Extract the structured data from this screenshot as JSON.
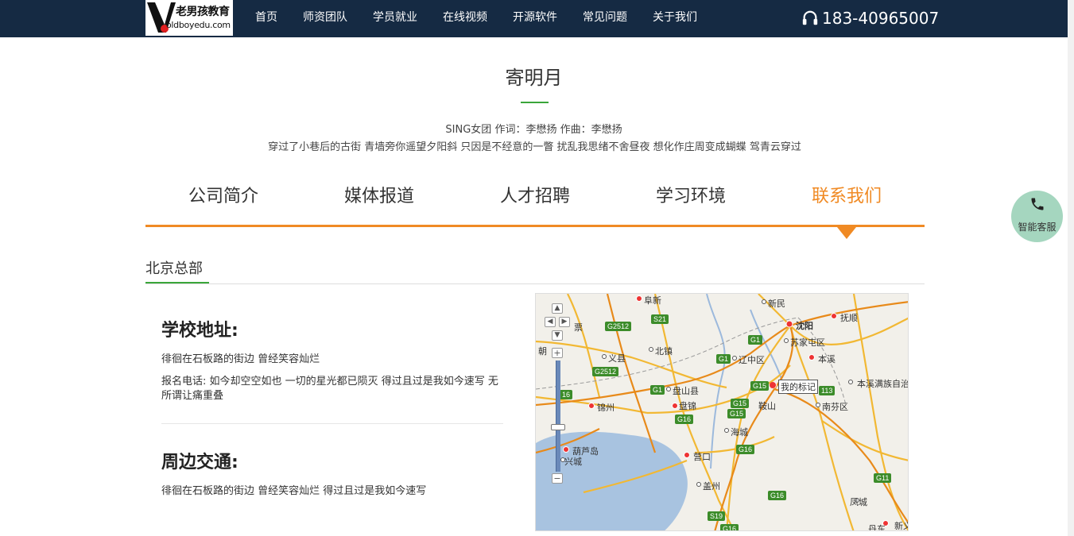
{
  "header": {
    "logo_cn": "老男孩教育",
    "logo_url": "oldboyedu.com",
    "nav": [
      "首页",
      "师资团队",
      "学员就业",
      "在线视频",
      "开源软件",
      "常见问题",
      "关于我们"
    ],
    "phone": "183-40965007",
    "phone_icon": "headphones-icon"
  },
  "title": {
    "main": "寄明月",
    "subtitle": "SING女团 作词：李懋扬 作曲：李懋扬",
    "lyric": "穿过了小巷后的古街 青墙旁你遥望夕阳斜 只因是不经意的一瞥 扰乱我思绪不舍昼夜 想化作庄周变成蝴蝶 驾青云穿过"
  },
  "tabs": {
    "items": [
      "公司简介",
      "媒体报道",
      "人才招聘",
      "学习环境",
      "联系我们"
    ],
    "active": 4
  },
  "section": {
    "title": "北京总部"
  },
  "address": {
    "heading": "学校地址:",
    "line1": "徘徊在石板路的街边 曾经笑容灿烂",
    "line2": "报名电话: 如今却空空如也 一切的星光都已陨灭 得过且过是我如今速写 无所谓让痛重叠"
  },
  "traffic": {
    "heading": "周边交通:",
    "line1": "徘徊在石板路的街边 曾经笑容灿烂 得过且过是我如今速写"
  },
  "map": {
    "marker_label": "我的标记",
    "places": [
      "阜新",
      "新民",
      "沈阳",
      "抚顺",
      "苏家屯区",
      "本溪",
      "辽中区",
      "义县",
      "北镇",
      "盘山县",
      "盘锦",
      "鞍山",
      "锦州",
      "海城",
      "南芬区",
      "本溪满族自治",
      "葫芦岛",
      "兴城",
      "营口",
      "盖州",
      "凤城",
      "丹东",
      "新义",
      "朝",
      "票"
    ],
    "roads": [
      "G2512",
      "S21",
      "G1",
      "G1",
      "G2512",
      "G1",
      "G15",
      "G15",
      "G16",
      "G16",
      "G15",
      "G16",
      "G16",
      "S19",
      "G11",
      "113",
      "16"
    ]
  },
  "service": {
    "label": "智能客服",
    "icon": "phone-icon"
  }
}
